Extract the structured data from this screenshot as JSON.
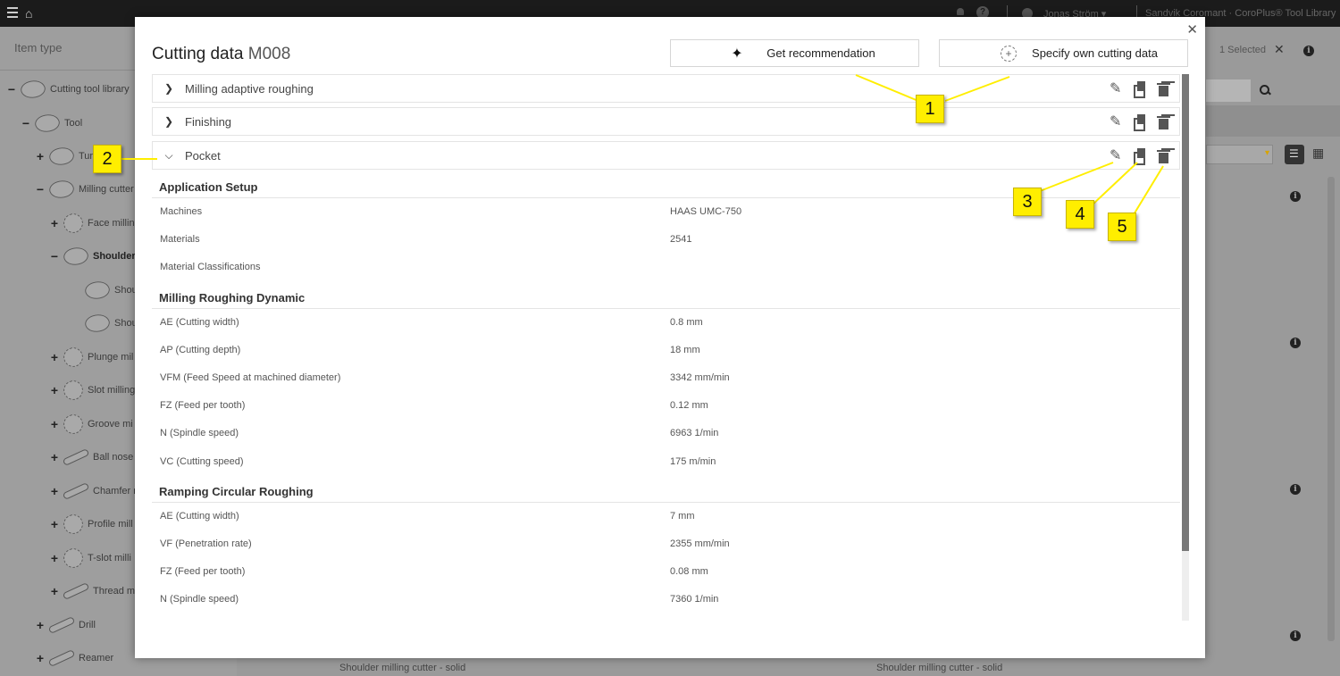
{
  "topbar": {
    "user": "Jonas Ström ▾",
    "brand": "Sandvik Coromant · CoroPlus® Tool Library"
  },
  "left": {
    "item_type": "Item type",
    "tree": [
      {
        "label": "Cutting tool library",
        "pm": "−"
      },
      {
        "label": "Tool",
        "pm": "−"
      },
      {
        "label": "Turni",
        "pm": "+"
      },
      {
        "label": "Milling cutter",
        "pm": "−"
      },
      {
        "label": "Face millin",
        "pm": "+"
      },
      {
        "label": "Shoulder",
        "pm": "−"
      },
      {
        "label": "Shoulder",
        "pm": ""
      },
      {
        "label": "Shoulder",
        "pm": ""
      },
      {
        "label": "Plunge mil",
        "pm": "+"
      },
      {
        "label": "Slot milling",
        "pm": "+"
      },
      {
        "label": "Groove mi",
        "pm": "+"
      },
      {
        "label": "Ball nose m",
        "pm": "+"
      },
      {
        "label": "Chamfer m",
        "pm": "+"
      },
      {
        "label": "Profile mill",
        "pm": "+"
      },
      {
        "label": "T-slot milli",
        "pm": "+"
      },
      {
        "label": "Thread mi",
        "pm": "+"
      },
      {
        "label": "Drill",
        "pm": "+"
      },
      {
        "label": "Reamer",
        "pm": "+"
      }
    ]
  },
  "right": {
    "selected": "1 Selected",
    "card_labels": [
      "Shoulder milling cutter - solid",
      "Shoulder milling cutter - solid"
    ]
  },
  "modal": {
    "title": "Cutting data",
    "code": "M008",
    "btn_recommendation": "Get recommendation",
    "btn_own": "Specify own cutting data",
    "accordions": [
      {
        "label": "Milling adaptive roughing",
        "chevron": "❯"
      },
      {
        "label": "Finishing",
        "chevron": "❯"
      },
      {
        "label": "Pocket",
        "chevron": "⌵"
      }
    ],
    "sections": [
      {
        "title": "Application Setup",
        "rows": [
          {
            "k": "Machines",
            "v": "HAAS UMC-750"
          },
          {
            "k": "Materials",
            "v": "2541"
          },
          {
            "k": "Material Classifications",
            "v": ""
          }
        ]
      },
      {
        "title": "Milling Roughing Dynamic",
        "rows": [
          {
            "k": "AE (Cutting width)",
            "v": "0.8 mm"
          },
          {
            "k": "AP (Cutting depth)",
            "v": "18 mm"
          },
          {
            "k": "VFM (Feed Speed at machined diameter)",
            "v": "3342 mm/min"
          },
          {
            "k": "FZ (Feed per tooth)",
            "v": "0.12 mm"
          },
          {
            "k": "N (Spindle speed)",
            "v": "6963 1/min"
          },
          {
            "k": "VC (Cutting speed)",
            "v": "175 m/min"
          }
        ]
      },
      {
        "title": "Ramping Circular Roughing",
        "rows": [
          {
            "k": "AE (Cutting width)",
            "v": "7 mm"
          },
          {
            "k": "VF (Penetration rate)",
            "v": "2355 mm/min"
          },
          {
            "k": "FZ (Feed per tooth)",
            "v": "0.08 mm"
          },
          {
            "k": "N (Spindle speed)",
            "v": "7360 1/min"
          }
        ]
      }
    ]
  },
  "callouts": [
    "1",
    "2",
    "3",
    "4",
    "5"
  ],
  "colors": {
    "callout": "#ffee00",
    "topbar": "#1b1b1b"
  }
}
